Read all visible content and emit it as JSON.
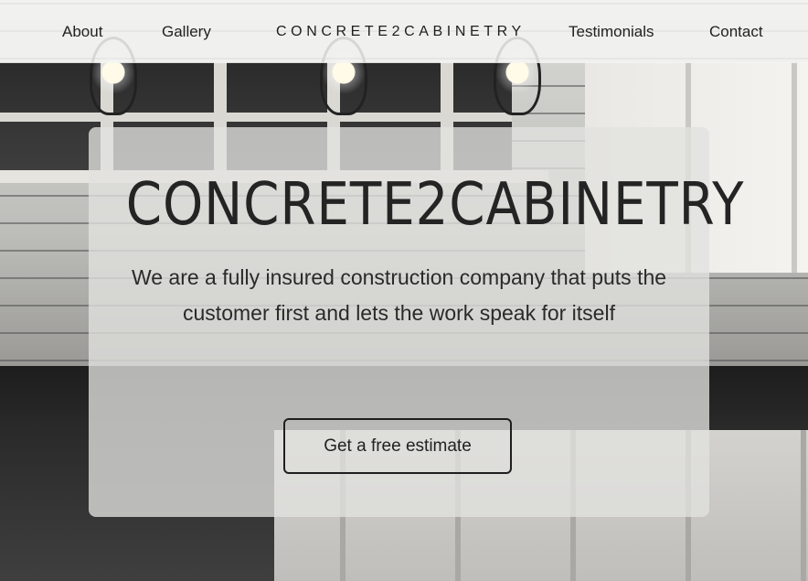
{
  "nav": {
    "about": "About",
    "gallery": "Gallery",
    "brand": "CONCRETE2CABINETRY",
    "testimonials": "Testimonials",
    "contact": "Contact"
  },
  "hero": {
    "title": "CONCRETE2CABINETRY",
    "text": "We are a fully insured construction company that puts the customer first and lets the work speak for itself",
    "cta_label": "Get a free estimate"
  }
}
